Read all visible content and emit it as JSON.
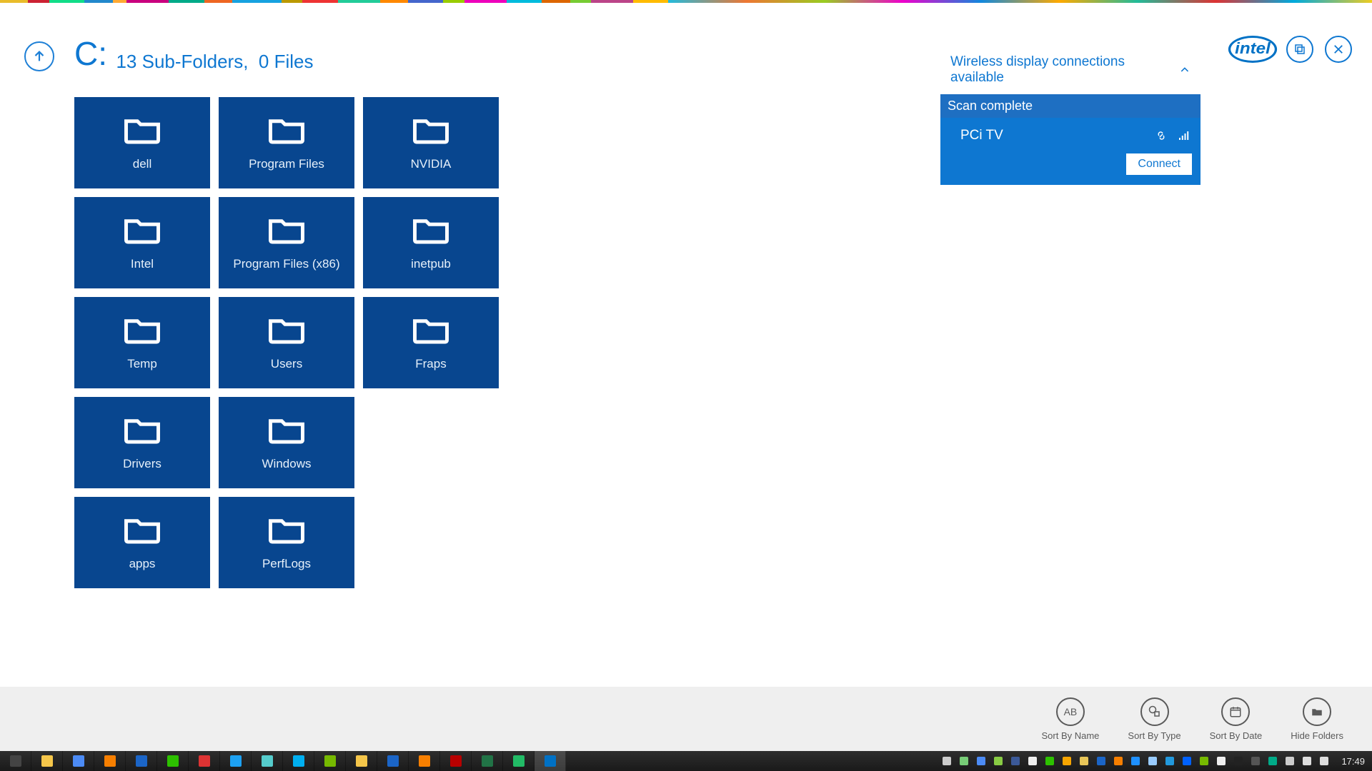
{
  "colors": {
    "accent": "#0e77d1",
    "tile": "#08468f"
  },
  "title": {
    "drive": "C:",
    "subfolders": "13 Sub-Folders,",
    "files": "0 Files"
  },
  "folders": [
    {
      "name": "dell"
    },
    {
      "name": "Program Files"
    },
    {
      "name": "NVIDIA"
    },
    {
      "name": "Intel"
    },
    {
      "name": "Program Files (x86)"
    },
    {
      "name": "inetpub"
    },
    {
      "name": "Temp"
    },
    {
      "name": "Users"
    },
    {
      "name": "Fraps"
    },
    {
      "name": "Drivers"
    },
    {
      "name": "Windows"
    },
    {
      "name": "apps"
    },
    {
      "name": "PerfLogs"
    }
  ],
  "widi": {
    "header": "Wireless display connections available",
    "status": "Scan complete",
    "device": "PCi TV",
    "connect": "Connect"
  },
  "logo": "intel",
  "sort": {
    "name": "Sort By Name",
    "name_icon": "AB",
    "type": "Sort By Type",
    "date": "Sort By Date",
    "hide": "Hide Folders"
  },
  "taskbar": {
    "clock": "17:49",
    "apps": [
      "start",
      "explorer",
      "chrome",
      "vlc",
      "outlook",
      "wechat",
      "snagit",
      "tweetdeck",
      "notepad",
      "skype",
      "nvidia",
      "explorer2",
      "rdp",
      "vlc2",
      "reader",
      "excel",
      "taskmgr",
      "intel-widi"
    ],
    "tray": [
      "keyboard",
      "safely-remove",
      "chrome",
      "leaf",
      "facebook",
      "onedrive",
      "sync",
      "updates",
      "mail",
      "outlook",
      "vlc",
      "bluetooth",
      "usb",
      "monitor",
      "dropbox",
      "nvidia",
      "flag",
      "processes",
      "display",
      "gfx",
      "network",
      "wifi",
      "volume"
    ]
  }
}
